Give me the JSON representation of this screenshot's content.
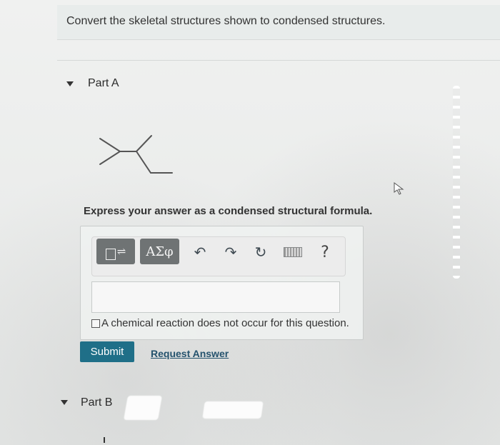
{
  "header": {
    "instruction": "Convert the skeletal structures shown to condensed structures."
  },
  "part_a": {
    "label": "Part A",
    "prompt": "Express your answer as a condensed structural formula.",
    "toolbar": {
      "templates_icon": "templates-icon",
      "symbols_label": "ΑΣφ",
      "undo_icon": "undo-icon",
      "redo_icon": "redo-icon",
      "reset_icon": "reset-icon",
      "keyboard_icon": "keyboard-icon",
      "help_label": "?"
    },
    "answer_value": "",
    "no_reaction_label": "A chemical reaction does not occur for this question.",
    "submit_label": "Submit",
    "request_answer_label": "Request Answer"
  },
  "part_b": {
    "label": "Part B"
  },
  "colors": {
    "submit_bg": "#1f6f88",
    "link": "#24526d",
    "toolbar_button": "#6f7374"
  }
}
